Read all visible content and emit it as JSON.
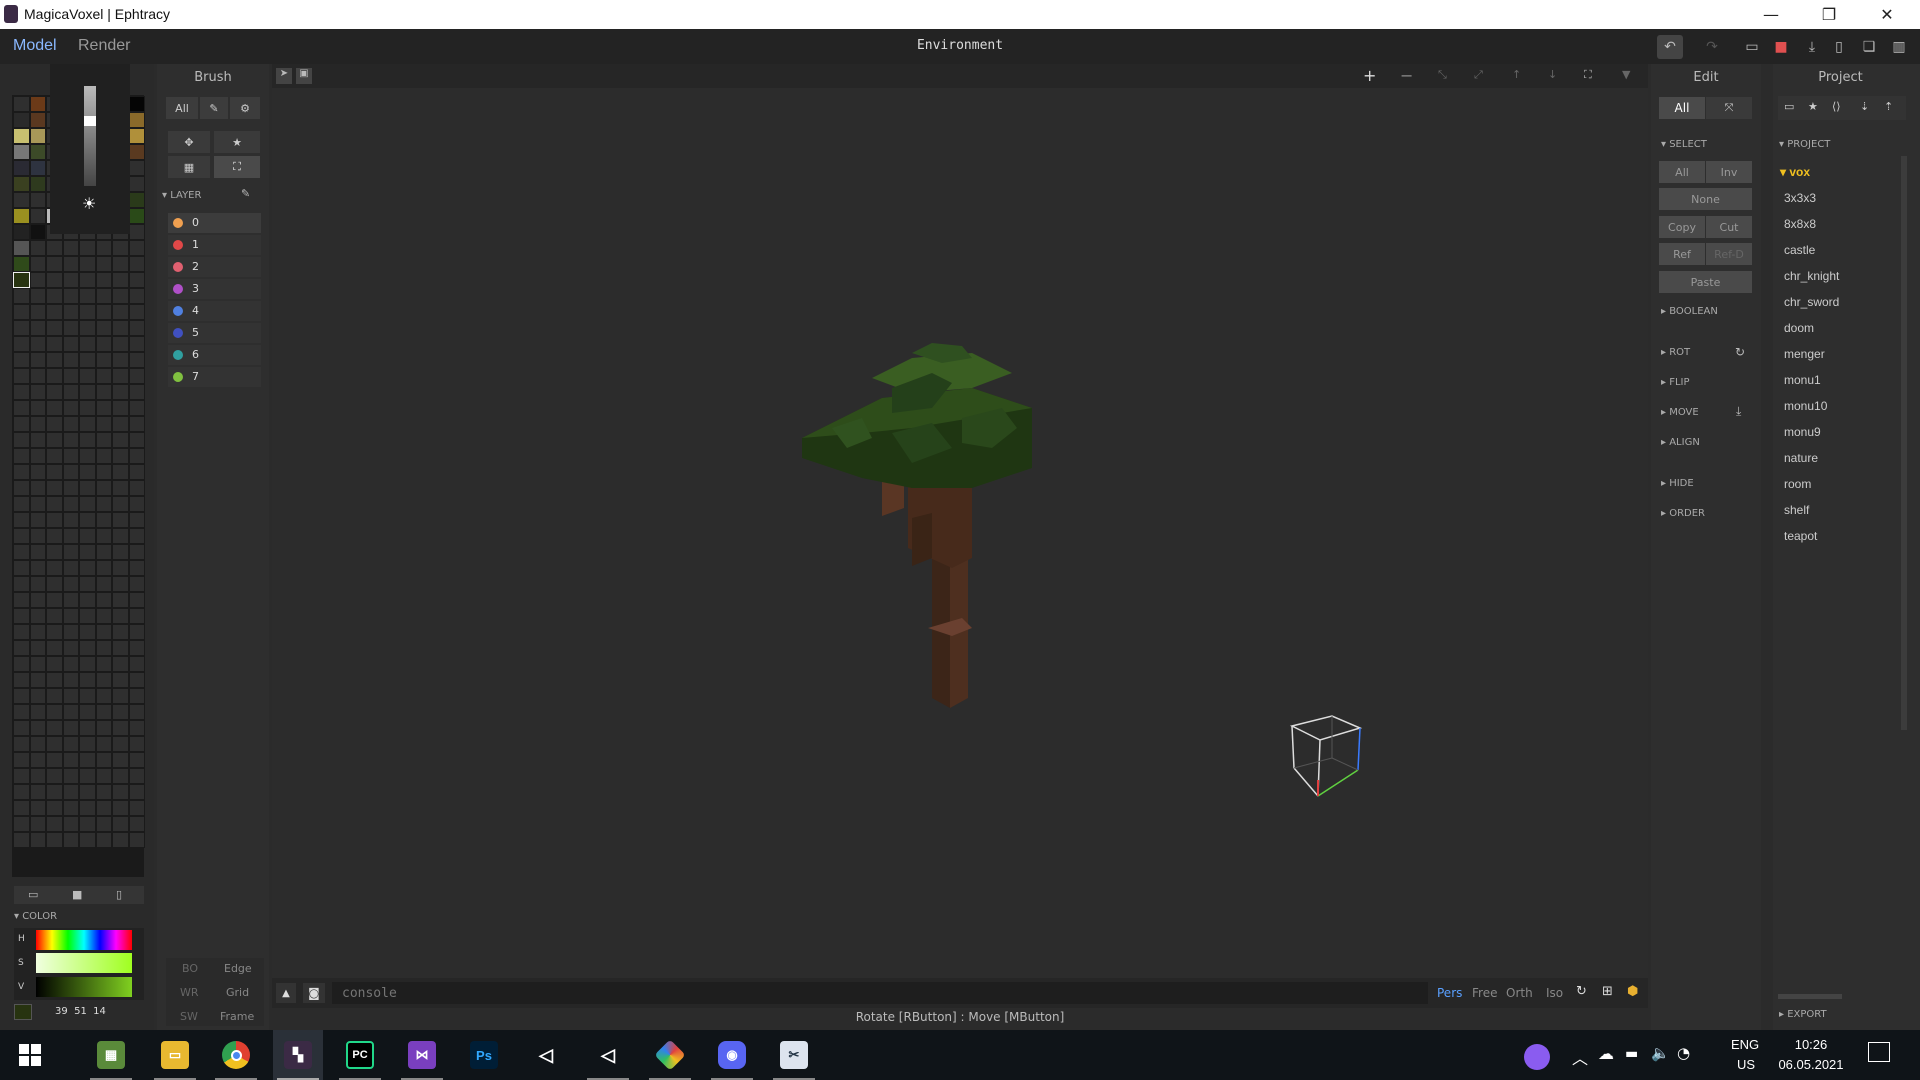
{
  "window": {
    "title": "MagicaVoxel | Ephtracy",
    "minimize": "—",
    "restore": "❐",
    "close": "✕"
  },
  "appbar": {
    "tabs": [
      "Model",
      "Render"
    ],
    "center_title": "Environment"
  },
  "brush_panel": {
    "header": "Brush",
    "all_label": "All",
    "layer_section": "LAYER",
    "layers": [
      {
        "id": "0",
        "color": "#f0a050"
      },
      {
        "id": "1",
        "color": "#e04848"
      },
      {
        "id": "2",
        "color": "#e06070"
      },
      {
        "id": "3",
        "color": "#b050c8"
      },
      {
        "id": "4",
        "color": "#5080e0"
      },
      {
        "id": "5",
        "color": "#4050c0"
      },
      {
        "id": "6",
        "color": "#30a0a0"
      },
      {
        "id": "7",
        "color": "#80c040"
      }
    ],
    "render_toggles": [
      [
        "BO",
        "Edge"
      ],
      [
        "WR",
        "Grid"
      ],
      [
        "SW",
        "Frame"
      ]
    ]
  },
  "color_panel": {
    "section": "COLOR",
    "hsv_labels": [
      "H",
      "S",
      "V"
    ],
    "value": "39  51  14"
  },
  "viewport": {
    "console_placeholder": "console",
    "camera_modes": [
      "Pers",
      "Free",
      "Orth",
      "Iso"
    ],
    "active_camera": "Pers",
    "status": "Rotate [RButton] : Move [MButton]"
  },
  "edit_panel": {
    "header": "Edit",
    "all_label": "All",
    "select_section": "SELECT",
    "buttons": {
      "all": "All",
      "inv": "Inv",
      "none": "None",
      "copy": "Copy",
      "cut": "Cut",
      "ref": "Ref",
      "ref_d": "Ref-D",
      "paste": "Paste"
    },
    "sections": [
      "BOOLEAN",
      "ROT",
      "FLIP",
      "MOVE",
      "ALIGN",
      "HIDE",
      "ORDER"
    ]
  },
  "project_panel": {
    "header": "Project",
    "section": "PROJECT",
    "folder": "vox",
    "items": [
      "3x3x3",
      "8x8x8",
      "castle",
      "chr_knight",
      "chr_sword",
      "doom",
      "menger",
      "monu1",
      "monu10",
      "monu9",
      "nature",
      "room",
      "shelf",
      "teapot"
    ],
    "export": "EXPORT"
  },
  "taskbar": {
    "lang": "ENG",
    "region": "US",
    "time": "10:26",
    "date": "06.05.2021",
    "apps": [
      "start",
      "minecraft",
      "explorer",
      "chrome",
      "magicavoxel",
      "pycharm",
      "visual-studio",
      "photoshop",
      "unity",
      "unity-2",
      "git",
      "discord",
      "snip"
    ]
  },
  "colors": {
    "accent": "#5aa0ff",
    "leaf": "#2c4a1e",
    "trunk": "#4a2c1c"
  }
}
